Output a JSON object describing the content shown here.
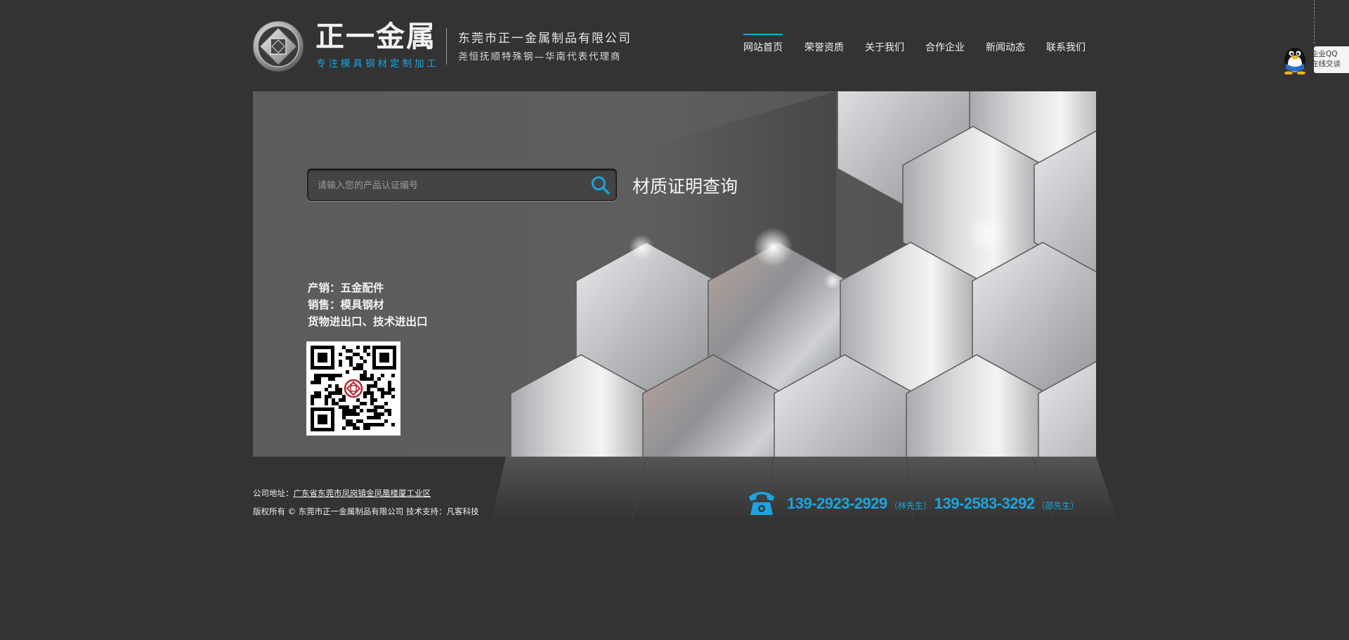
{
  "header": {
    "brand_name": "正一金属",
    "brand_tagline": "专注模具钢材定制加工",
    "company_name": "东莞市正一金属制品有限公司",
    "company_sub": "尧恒抚顺特殊钢—华南代表代理商"
  },
  "nav": {
    "items": [
      {
        "label": "网站首页",
        "active": true
      },
      {
        "label": "荣誉资质"
      },
      {
        "label": "关于我们"
      },
      {
        "label": "合作企业"
      },
      {
        "label": "新闻动态"
      },
      {
        "label": "联系我们"
      }
    ]
  },
  "qq_widget": {
    "line1": "企业QQ",
    "line2": "在线交谈"
  },
  "search": {
    "placeholder": "请输入您的产品认证编号",
    "title": "材质证明查询"
  },
  "info": {
    "line1": "产销：五金配件",
    "line2": "销售：模具钢材",
    "line3": "货物进出口、技术进出口"
  },
  "footer": {
    "address_label": "公司地址：",
    "address_value": "广东省东莞市凤岗镇金凤凰楼厦工业区",
    "copyright": "版权所有 © 东莞市正一金属制品有限公司 技术支持：凡客科技",
    "phone1": "139-2923-2929",
    "contact1": "（林先生）",
    "phone2": "139-2583-3292",
    "contact2": "（邵先生）"
  },
  "colors": {
    "accent": "#1aa5e0",
    "background": "#333333",
    "banner": "#5f5f5f"
  }
}
